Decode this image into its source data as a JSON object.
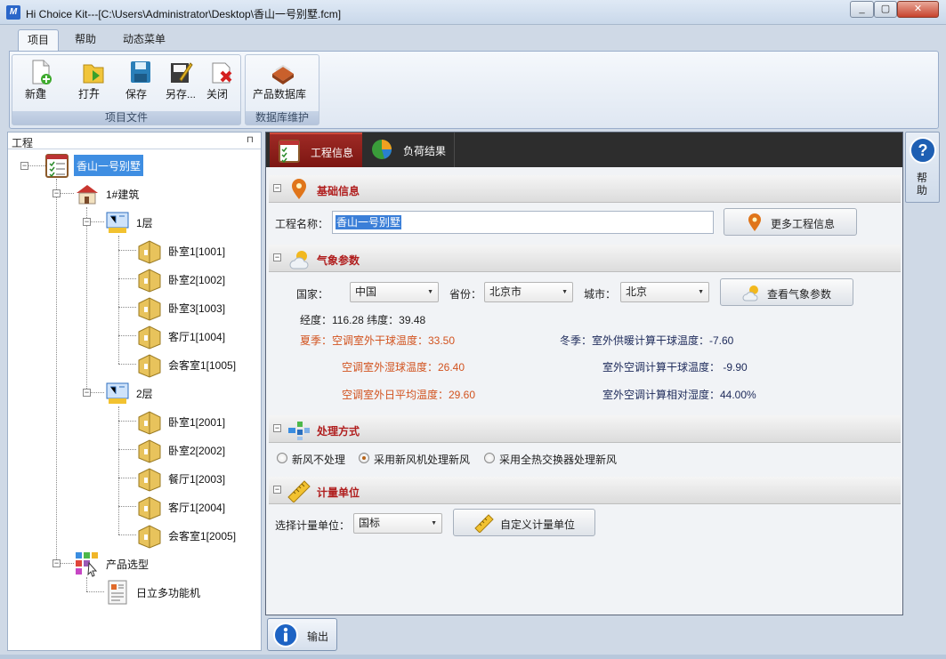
{
  "window": {
    "title": "Hi Choice Kit---[C:\\Users\\Administrator\\Desktop\\香山一号别墅.fcm]",
    "app_icon_text": "M",
    "min": "▭",
    "max": "▢",
    "close": "✕"
  },
  "ribbon": {
    "tabs": [
      "项目",
      "帮助",
      "动态菜单"
    ],
    "groups": [
      {
        "label": "项目文件",
        "buttons": [
          "新建",
          "打开",
          "保存",
          "另存...",
          "关闭"
        ]
      },
      {
        "label": "数据库维护",
        "buttons": [
          "产品数据库"
        ]
      }
    ]
  },
  "tree": {
    "header": "工程",
    "pin": "⊓",
    "root": "香山一号别墅",
    "building": "1#建筑",
    "floors": [
      {
        "label": "1层",
        "rooms": [
          "卧室1[1001]",
          "卧室2[1002]",
          "卧室3[1003]",
          "客厅1[1004]",
          "会客室1[1005]"
        ]
      },
      {
        "label": "2层",
        "rooms": [
          "卧室1[2001]",
          "卧室2[2002]",
          "餐厅1[2003]",
          "客厅1[2004]",
          "会客室1[2005]"
        ]
      }
    ],
    "product": "产品选型",
    "product_item": "日立多功能机"
  },
  "center": {
    "tabs": [
      "工程信息",
      "负荷结果"
    ],
    "basic": {
      "title": "基础信息",
      "name_label": "工程名称：",
      "name_value": "香山一号别墅",
      "more_button": "更多工程信息"
    },
    "weather": {
      "title": "气象参数",
      "country_label": "国家：",
      "country_value": "中国",
      "province_label": "省份：",
      "province_value": "北京市",
      "city_label": "城市：",
      "city_value": "北京",
      "view_button": "查看气象参数",
      "coords": "经度：116.28 纬度：39.48",
      "summer_dry": "夏季：空调室外干球温度：33.50",
      "summer_wet": "空调室外湿球温度：26.40",
      "summer_avg": "空调室外日平均温度：29.60",
      "winter_heat": "冬季：室外供暖计算干球温度：-7.60",
      "winter_dry": "室外空调计算干球温度： -9.90",
      "winter_rh": "室外空调计算相对湿度：44.00%"
    },
    "process": {
      "title": "处理方式",
      "options": [
        "新风不处理",
        "采用新风机处理新风",
        "采用全热交换器处理新风"
      ],
      "selected_index": 1
    },
    "units": {
      "title": "计量单位",
      "select_label": "选择计量单位：",
      "select_value": "国标",
      "custom_button": "自定义计量单位"
    },
    "collapse": "⊟",
    "dropdown_arrow": "▼"
  },
  "side": {
    "help_label": "帮助"
  },
  "output": {
    "label": "输出"
  },
  "colors": {
    "accent_red": "#b01e1e",
    "orange_text": "#d2531f",
    "navy_text": "#1d2a5a",
    "selection_blue": "#3f8ee2"
  }
}
